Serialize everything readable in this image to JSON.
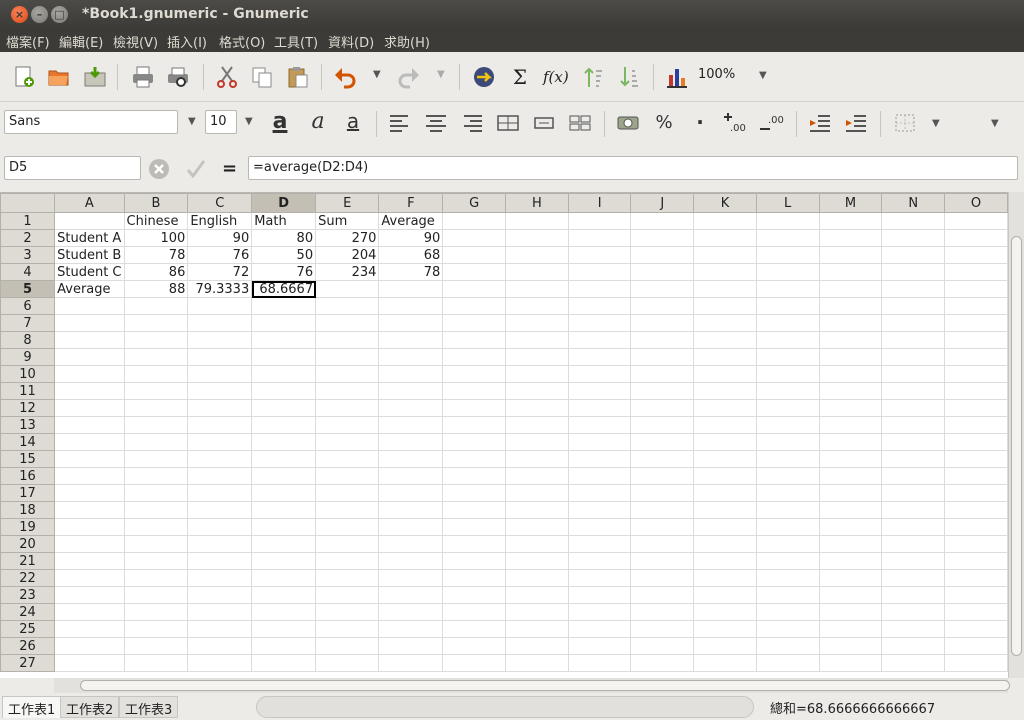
{
  "window": {
    "title": "*Book1.gnumeric - Gnumeric"
  },
  "menu": [
    "檔案(F)",
    "編輯(E)",
    "檢視(V)",
    "插入(I)",
    "格式(O)",
    "工具(T)",
    "資料(D)",
    "求助(H)"
  ],
  "toolbar": {
    "zoom": "100%",
    "fx_label": "f(x)",
    "sigma_label": "Σ"
  },
  "format": {
    "font_name": "Sans",
    "font_size": "10",
    "percent_label": "%",
    "decimal_label": "·"
  },
  "formula": {
    "cell_ref": "D5",
    "equals": "=",
    "content": "=average(D2:D4)"
  },
  "columns": [
    "A",
    "B",
    "C",
    "D",
    "E",
    "F",
    "G",
    "H",
    "I",
    "J",
    "K",
    "L",
    "M",
    "N",
    "O"
  ],
  "selected_column": "D",
  "selected_row": "5",
  "rows": [
    [
      "",
      "Chinese",
      "English",
      "Math",
      "Sum",
      "Average"
    ],
    [
      "Student A",
      "100",
      "90",
      "80",
      "270",
      "90"
    ],
    [
      "Student B",
      "78",
      "76",
      "50",
      "204",
      "68"
    ],
    [
      "Student C",
      "86",
      "72",
      "76",
      "234",
      "78"
    ],
    [
      "Average",
      "88",
      "79.3333",
      "68.6667",
      "",
      ""
    ]
  ],
  "row_numbers": [
    "1",
    "2",
    "3",
    "4",
    "5",
    "6",
    "7",
    "8",
    "9",
    "10",
    "11",
    "12",
    "13",
    "14",
    "15",
    "16",
    "17",
    "18",
    "19",
    "20",
    "21",
    "22",
    "23",
    "24",
    "25",
    "26",
    "27"
  ],
  "sheets": [
    "工作表1",
    "工作表2",
    "工作表3"
  ],
  "status": {
    "sum": "總和=68.6666666666667"
  },
  "colors": {
    "titlebar": "#3c3b37",
    "close_button": "#dd4814",
    "header_bg": "#dedbd5",
    "selected_header": "#c3bfb4"
  }
}
